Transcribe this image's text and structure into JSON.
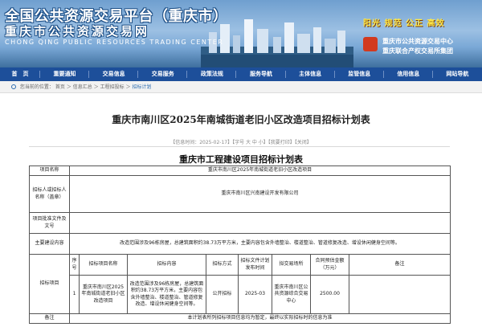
{
  "header": {
    "title": "全国公共资源交易平台（重庆市）",
    "subtitle": "重庆市公共资源交易网",
    "english": "CHONG QING PUBLIC RESOURCES TRADING CENTER",
    "slogan": "阳光  规范  公正  高效",
    "org_line1": "重庆市公共资源交易中心",
    "org_line2": "重庆联合产权交易所集团"
  },
  "nav": {
    "items": [
      "首　页",
      "重要通知",
      "交易信息",
      "交易服务",
      "政策法规",
      "服务导航",
      "主体信息",
      "监管信息",
      "信用信息",
      "网站导航"
    ]
  },
  "breadcrumb": {
    "prefix": "您当前的位置：",
    "items": [
      "首页",
      "信息汇总",
      "工程招投标",
      "招标计划"
    ],
    "separator": "＞"
  },
  "article": {
    "title": "重庆市南川区2025年南城街道老旧小区改造项目招标计划表",
    "meta": "【信息时间：2025-02-17】【字号 大 中 小】【我要打印】【关闭】"
  },
  "document": {
    "title": "重庆市工程建设项目招标计划表",
    "project_name_label": "项目名称",
    "project_name": "重庆市南川区2025年南城街道老旧小区改造项目",
    "tenderer_label": "招标人或招标人名称（盖章）",
    "tenderer": "重庆市南川区兴南建设开发有限公司",
    "approval_label": "项目批准文件及文号",
    "approval": "",
    "content_label": "主要建设内容",
    "content": "改造范围涉及96栋房屋，总建筑面积约38.73万平方米，主要内容包含外墙整治、楼道整治、管道修复改造、增设休闲健身空间等。",
    "plan_label": "招标项目",
    "columns": [
      "序号",
      "招标项目名称",
      "招标内容",
      "招标方式",
      "招标文件计划发布时间",
      "拟交易场所",
      "合同预估金额（万元）",
      "备注"
    ],
    "rows": [
      {
        "no": "1",
        "name": "重庆市南川区2025年南城街道老旧小区改造项目",
        "content": "改造范围涉及96栋房屋，总建筑面积约38.73万平方米，主要内容包含外墙整治、楼道整治、管道修复改造、增设休闲健身空间等。",
        "method": "公开招标",
        "date": "2025-03",
        "venue": "重庆市南川区公共资源综合交易中心",
        "amount": "2500.00",
        "remark": ""
      }
    ],
    "note_label": "备注",
    "note": "本计划表所列招标项目信息均为暂定，最终以实际招标时的信息为准"
  }
}
